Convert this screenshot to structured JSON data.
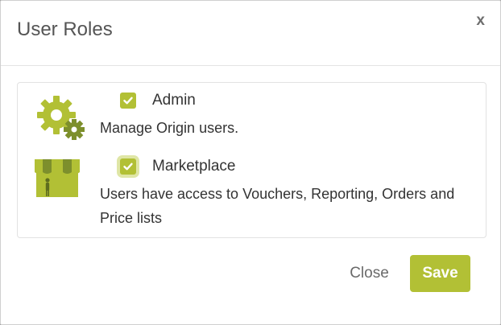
{
  "dialog": {
    "title": "User Roles",
    "close_glyph": "x"
  },
  "roles": [
    {
      "icon": "gear-icon",
      "name": "Admin",
      "checked": true,
      "description": "Manage Origin users."
    },
    {
      "icon": "storefront-icon",
      "name": "Marketplace",
      "checked": true,
      "description": "Users have access to Vouchers, Reporting, Orders and Price lists"
    }
  ],
  "footer": {
    "close_label": "Close",
    "save_label": "Save"
  },
  "colors": {
    "accent": "#b2c035",
    "accent_dark": "#7d8f2c",
    "text": "#333333"
  }
}
